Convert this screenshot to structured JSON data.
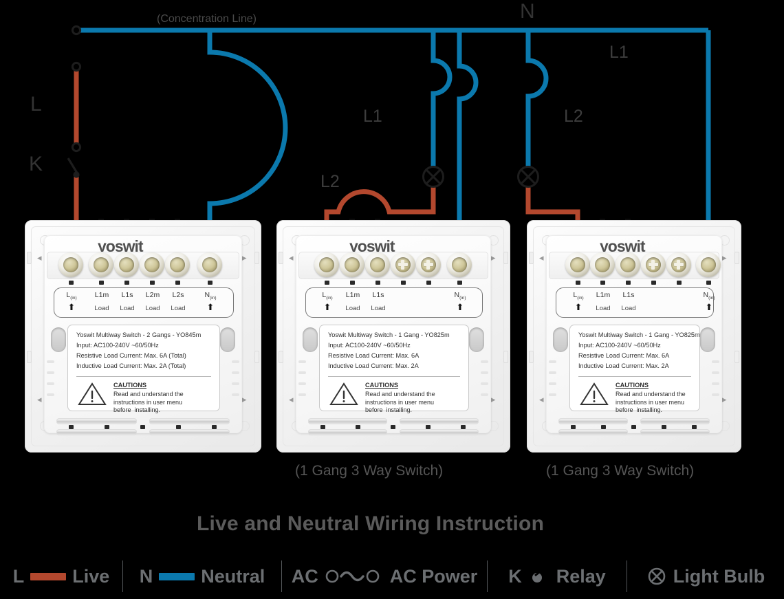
{
  "diagram": {
    "title": "Live and Neutral Wiring Instruction",
    "top_note": "(Concentration Line)",
    "node_labels": {
      "L": "L",
      "K": "K",
      "N": "N",
      "L1_left": "L1",
      "L1_right": "L1",
      "L2_left": "L2",
      "L2_right": "L2"
    },
    "captions": {
      "panel2": "(1 Gang 3 Way Switch)",
      "panel3": "(1 Gang 3 Way Switch)"
    }
  },
  "colors": {
    "live": "#b3482e",
    "neutral": "#0b79ad",
    "load": "#111111",
    "text": "#3a3a3a",
    "title": "#5b5b5b",
    "legend_text": "#6c6f72",
    "background": "#000000"
  },
  "panels": [
    {
      "id": "panel-1",
      "brand": "yoswit",
      "terminals": [
        {
          "label": "L",
          "sub": "(in)",
          "foot": "arrow",
          "wire": "live"
        },
        {
          "label": "L1m",
          "sub": "",
          "foot": "Load",
          "wire": "load"
        },
        {
          "label": "L1s",
          "sub": "",
          "foot": "Load",
          "wire": "load"
        },
        {
          "label": "L2m",
          "sub": "",
          "foot": "Load",
          "wire": "load"
        },
        {
          "label": "L2s",
          "sub": "",
          "foot": "Load",
          "wire": "load"
        },
        {
          "label": "N",
          "sub": "(in)",
          "foot": "arrow",
          "wire": "neutral"
        }
      ],
      "spec": {
        "model": "Yoswit Multiway Switch - 2 Gangs - YO845m",
        "input": "Input: AC100-240V ~60/50Hz",
        "resistive": "Resistive Load Current: Max. 6A (Total)",
        "inductive": "Inductive Load Current: Max. 2A (Total)",
        "cautions_title": "CAUTIONS",
        "cautions_body": "Read and understand the\ninstructions in user menu\nbefore  installing."
      }
    },
    {
      "id": "panel-2",
      "brand": "yoswit",
      "terminals": [
        {
          "label": "L",
          "sub": "(in)",
          "foot": "arrow",
          "wire": "live"
        },
        {
          "label": "L1m",
          "sub": "",
          "foot": "Load",
          "wire": "load"
        },
        {
          "label": "L1s",
          "sub": "",
          "foot": "Load",
          "wire": "load"
        },
        {
          "label": "",
          "sub": "",
          "foot": "",
          "wire": "none"
        },
        {
          "label": "",
          "sub": "",
          "foot": "",
          "wire": "none"
        },
        {
          "label": "N",
          "sub": "(in)",
          "foot": "arrow",
          "wire": "neutral"
        }
      ],
      "spec": {
        "model": "Yoswit Multiway Switch - 1 Gang - YO825m",
        "input": "Input: AC100-240V ~60/50Hz",
        "resistive": "Resistive Load Current: Max. 6A",
        "inductive": "Inductive Load Current: Max. 2A",
        "cautions_title": "CAUTIONS",
        "cautions_body": "Read and understand the\ninstructions in user menu\nbefore  installing."
      }
    },
    {
      "id": "panel-3",
      "brand": "yoswit",
      "terminals": [
        {
          "label": "L",
          "sub": "(in)",
          "foot": "arrow",
          "wire": "live"
        },
        {
          "label": "L1m",
          "sub": "",
          "foot": "Load",
          "wire": "load"
        },
        {
          "label": "L1s",
          "sub": "",
          "foot": "Load",
          "wire": "load"
        },
        {
          "label": "",
          "sub": "",
          "foot": "",
          "wire": "none"
        },
        {
          "label": "",
          "sub": "",
          "foot": "",
          "wire": "none"
        },
        {
          "label": "N",
          "sub": "(in)",
          "foot": "arrow",
          "wire": "neutral"
        }
      ],
      "spec": {
        "model": "Yoswit Multiway Switch - 1 Gang - YO825m",
        "input": "Input: AC100-240V ~60/50Hz",
        "resistive": "Resistive Load Current: Max. 6A",
        "inductive": "Inductive Load Current: Max. 2A",
        "cautions_title": "CAUTIONS",
        "cautions_body": "Read and understand the\ninstructions in user menu\nbefore  installing."
      }
    }
  ],
  "legend": [
    {
      "key": "L",
      "label": "Live",
      "symbol": "swatch-live"
    },
    {
      "key": "N",
      "label": "Neutral",
      "symbol": "swatch-neutral"
    },
    {
      "key": "AC",
      "label": "AC Power",
      "symbol": "ac-source-icon"
    },
    {
      "key": "K",
      "label": "Relay",
      "symbol": "relay-icon"
    },
    {
      "key": "",
      "label": "Light Bulb",
      "symbol": "bulb-icon"
    }
  ]
}
